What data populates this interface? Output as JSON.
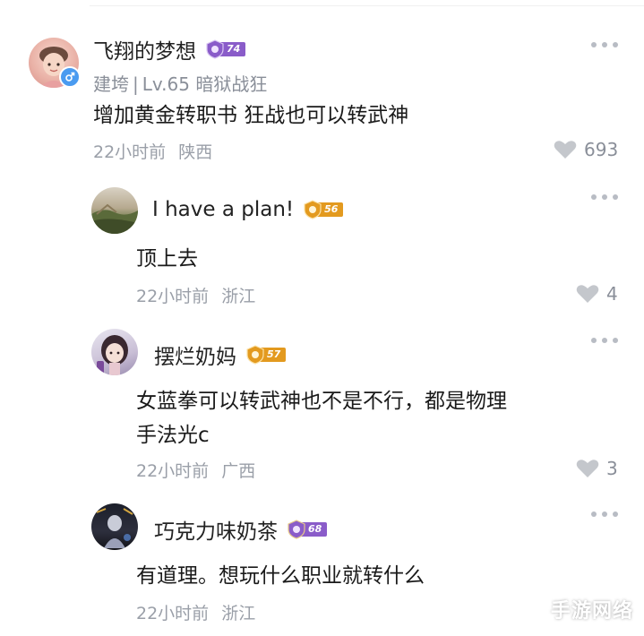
{
  "comments": [
    {
      "username": "飞翔的梦想",
      "level": "74",
      "meta": {
        "server": "建垮",
        "level_info": "Lv.65 暗狱战狂"
      },
      "text_lines": [
        "增加黄金转职书 狂战也可以转武神"
      ],
      "time": "22小时前",
      "region": "陕西",
      "likes": "693",
      "gender_icon": "male-icon"
    },
    {
      "username": "I have a plan!",
      "level": "56",
      "text_lines": [
        "顶上去"
      ],
      "time": "22小时前",
      "region": "浙江",
      "likes": "4"
    },
    {
      "username": "摆烂奶妈",
      "level": "57",
      "text_lines": [
        "女蓝拳可以转武神也不是不行，都是物理",
        "手法光c"
      ],
      "time": "22小时前",
      "region": "广西",
      "likes": "3"
    },
    {
      "username": "巧克力味奶茶",
      "level": "68",
      "text_lines": [
        "有道理。想玩什么职业就转什么"
      ],
      "time": "22小时前",
      "region": "浙江",
      "likes": ""
    }
  ],
  "watermark": "手游网络",
  "colors": {
    "badge_purple": "#8a5cc9",
    "badge_orange": "#e39a1f",
    "gender_blue": "#4a9bf0",
    "heart_gray": "#c4c7cc"
  }
}
